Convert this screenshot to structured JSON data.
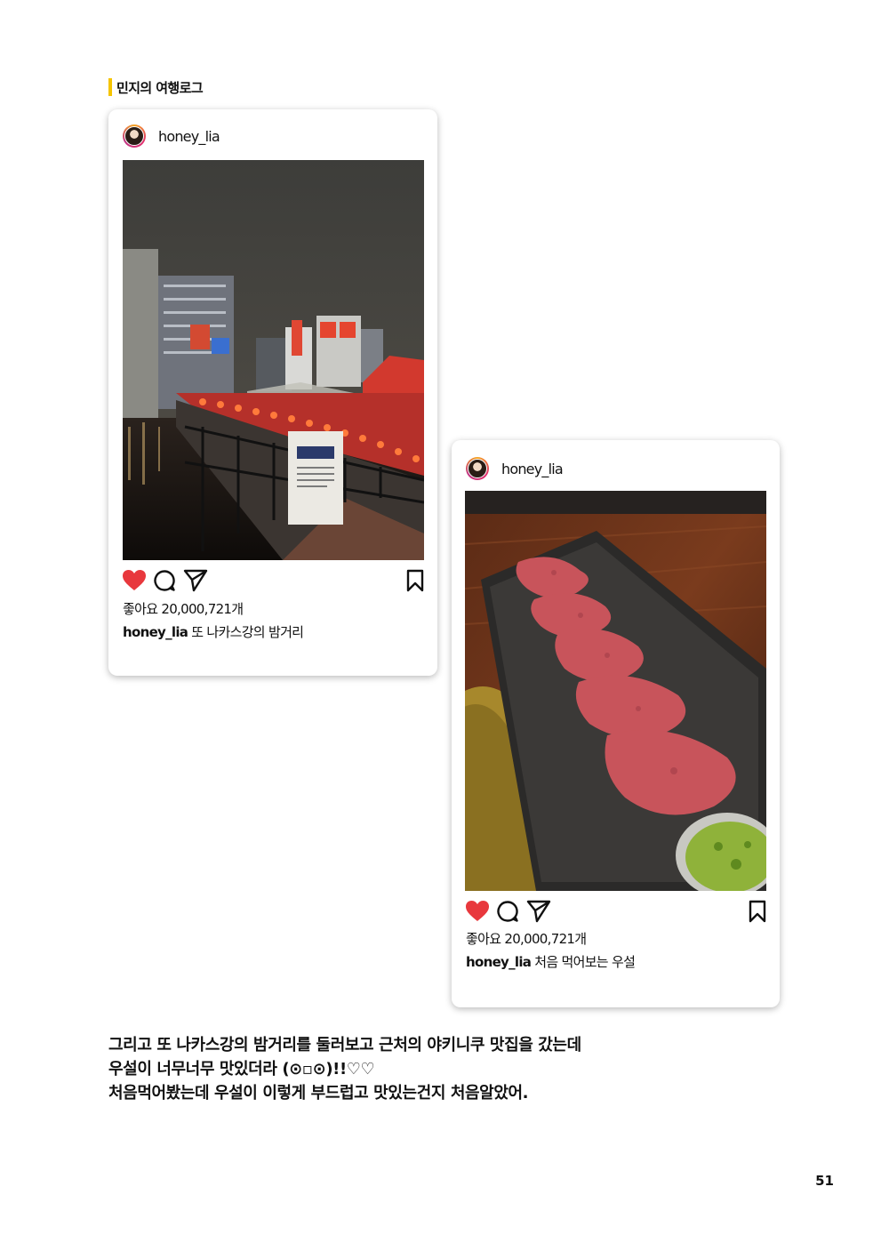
{
  "header": {
    "section_title": "민지의 여행로그"
  },
  "posts": [
    {
      "username": "honey_lia",
      "likes": "좋아요 20,000,721개",
      "caption_user": "honey_lia",
      "caption_text": "또 나카스강의 밤거리",
      "photo": "night-river-photo",
      "colors": {
        "like": "#e8383d"
      }
    },
    {
      "username": "honey_lia",
      "likes": "좋아요 20,000,721개",
      "caption_user": "honey_lia",
      "caption_text": "처음 먹어보는 우설",
      "photo": "beef-tongue-photo",
      "colors": {
        "like": "#e8383d"
      }
    }
  ],
  "body": {
    "lines": [
      "그리고 또 나카스강의 밤거리를 둘러보고 근처의 야키니쿠 맛집을 갔는데",
      "우설이 너무너무 맛있더라 (⊙▫⊙)!!♡♡",
      "처음먹어봤는데 우설이 이렇게 부드럽고 맛있는건지 처음알았어."
    ]
  },
  "footer": {
    "page_number": "51"
  }
}
